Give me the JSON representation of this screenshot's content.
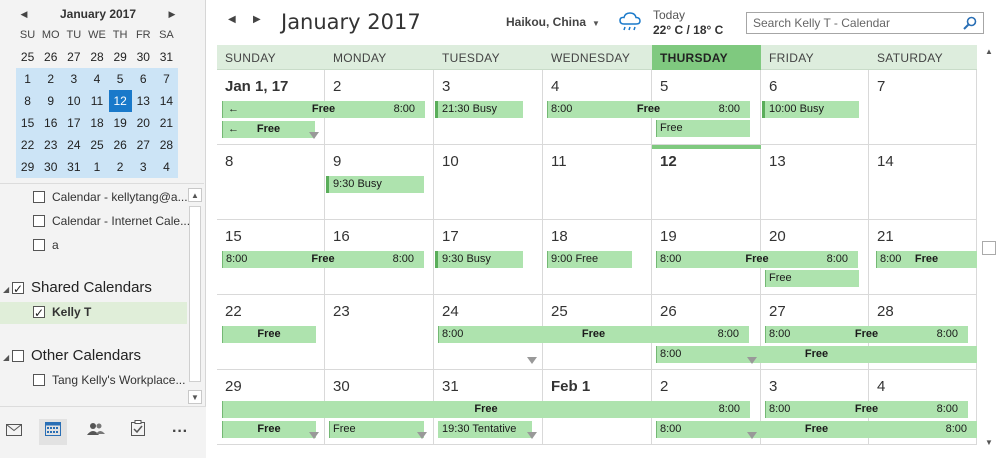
{
  "mini": {
    "title": "January 2017",
    "prev": "◀",
    "next": "▶",
    "dow": [
      "SU",
      "MO",
      "TU",
      "WE",
      "TH",
      "FR",
      "SA"
    ],
    "weeks": [
      [
        "25",
        "26",
        "27",
        "28",
        "29",
        "30",
        "31"
      ],
      [
        "1",
        "2",
        "3",
        "4",
        "5",
        "6",
        "7"
      ],
      [
        "8",
        "9",
        "10",
        "11",
        "12",
        "13",
        "14"
      ],
      [
        "15",
        "16",
        "17",
        "18",
        "19",
        "20",
        "21"
      ],
      [
        "22",
        "23",
        "24",
        "25",
        "26",
        "27",
        "28"
      ],
      [
        "29",
        "30",
        "31",
        "1",
        "2",
        "3",
        "4"
      ]
    ],
    "today": "12"
  },
  "folders": {
    "items": [
      {
        "label": "Calendar - kellytang@a...",
        "checked": false
      },
      {
        "label": "Calendar - Internet Cale...",
        "checked": false
      },
      {
        "label": "a",
        "checked": false
      }
    ],
    "shared_group": "Shared Calendars",
    "shared_item": "Kelly T",
    "other_group": "Other Calendars",
    "other_item": "Tang Kelly's Workplace..."
  },
  "header": {
    "title": "January 2017",
    "location": "Haikou, China",
    "weather_today": "Today",
    "weather_temp": "22° C / 18° C",
    "search_placeholder": "Search Kelly T - Calendar"
  },
  "days": [
    "SUNDAY",
    "MONDAY",
    "TUESDAY",
    "WEDNESDAY",
    "THURSDAY",
    "FRIDAY",
    "SATURDAY"
  ],
  "current_day_index": 4,
  "weeks": [
    [
      "Jan 1, 17",
      "2",
      "3",
      "4",
      "5",
      "6",
      "7"
    ],
    [
      "8",
      "9",
      "10",
      "11",
      "12",
      "13",
      "14"
    ],
    [
      "15",
      "16",
      "17",
      "18",
      "19",
      "20",
      "21"
    ],
    [
      "22",
      "23",
      "24",
      "25",
      "26",
      "27",
      "28"
    ],
    [
      "29",
      "30",
      "31",
      "Feb 1",
      "2",
      "3",
      "4"
    ]
  ],
  "events": {
    "w0a_free": "Free",
    "w0a_time": "8:00",
    "w0b_free": "Free",
    "w0_tue": "21:30 Busy",
    "w0_wed_time": "8:00",
    "w0_wed_free": "Free",
    "w0_wed_end": "8:00",
    "w0_thu": "Free",
    "w0_fri": "10:00 Busy",
    "w1_mon": "9:30 Busy",
    "w2_sun_time": "8:00",
    "w2_sun_free": "Free",
    "w2_sun_end": "8:00",
    "w2_tue": "9:30 Busy",
    "w2_wed": "9:00 Free",
    "w2_thu_time": "8:00",
    "w2_thu_free": "Free",
    "w2_thu_end": "8:00",
    "w2_fri": "Free",
    "w2_sat_time": "8:00",
    "w2_sat_free": "Free",
    "w3_sun": "Free",
    "w3_tue_time": "8:00",
    "w3_tue_free": "Free",
    "w3_tue_end": "8:00",
    "w3_thu_time": "8:00",
    "w3_thu_free": "Free",
    "w3_fri_time": "8:00",
    "w3_fri_free": "Free",
    "w3_fri_end": "8:00",
    "w4_sun_free": "Free",
    "w4_sun_end": "8:00",
    "w4_sun2": "Free",
    "w4_mon": "Free",
    "w4_tue": "19:30 Tentative",
    "w4_thu_time": "8:00",
    "w4_thu_free": "Free",
    "w4_thu_end": "8:00",
    "w4_fri_time": "8:00",
    "w4_fri_free": "Free",
    "w4_fri_end": "8:00"
  },
  "colors": {
    "accent": "#1979ca",
    "event_fill": "#aee3ae",
    "busy_bar": "#5aad5a",
    "today_header": "#7fc97f"
  }
}
